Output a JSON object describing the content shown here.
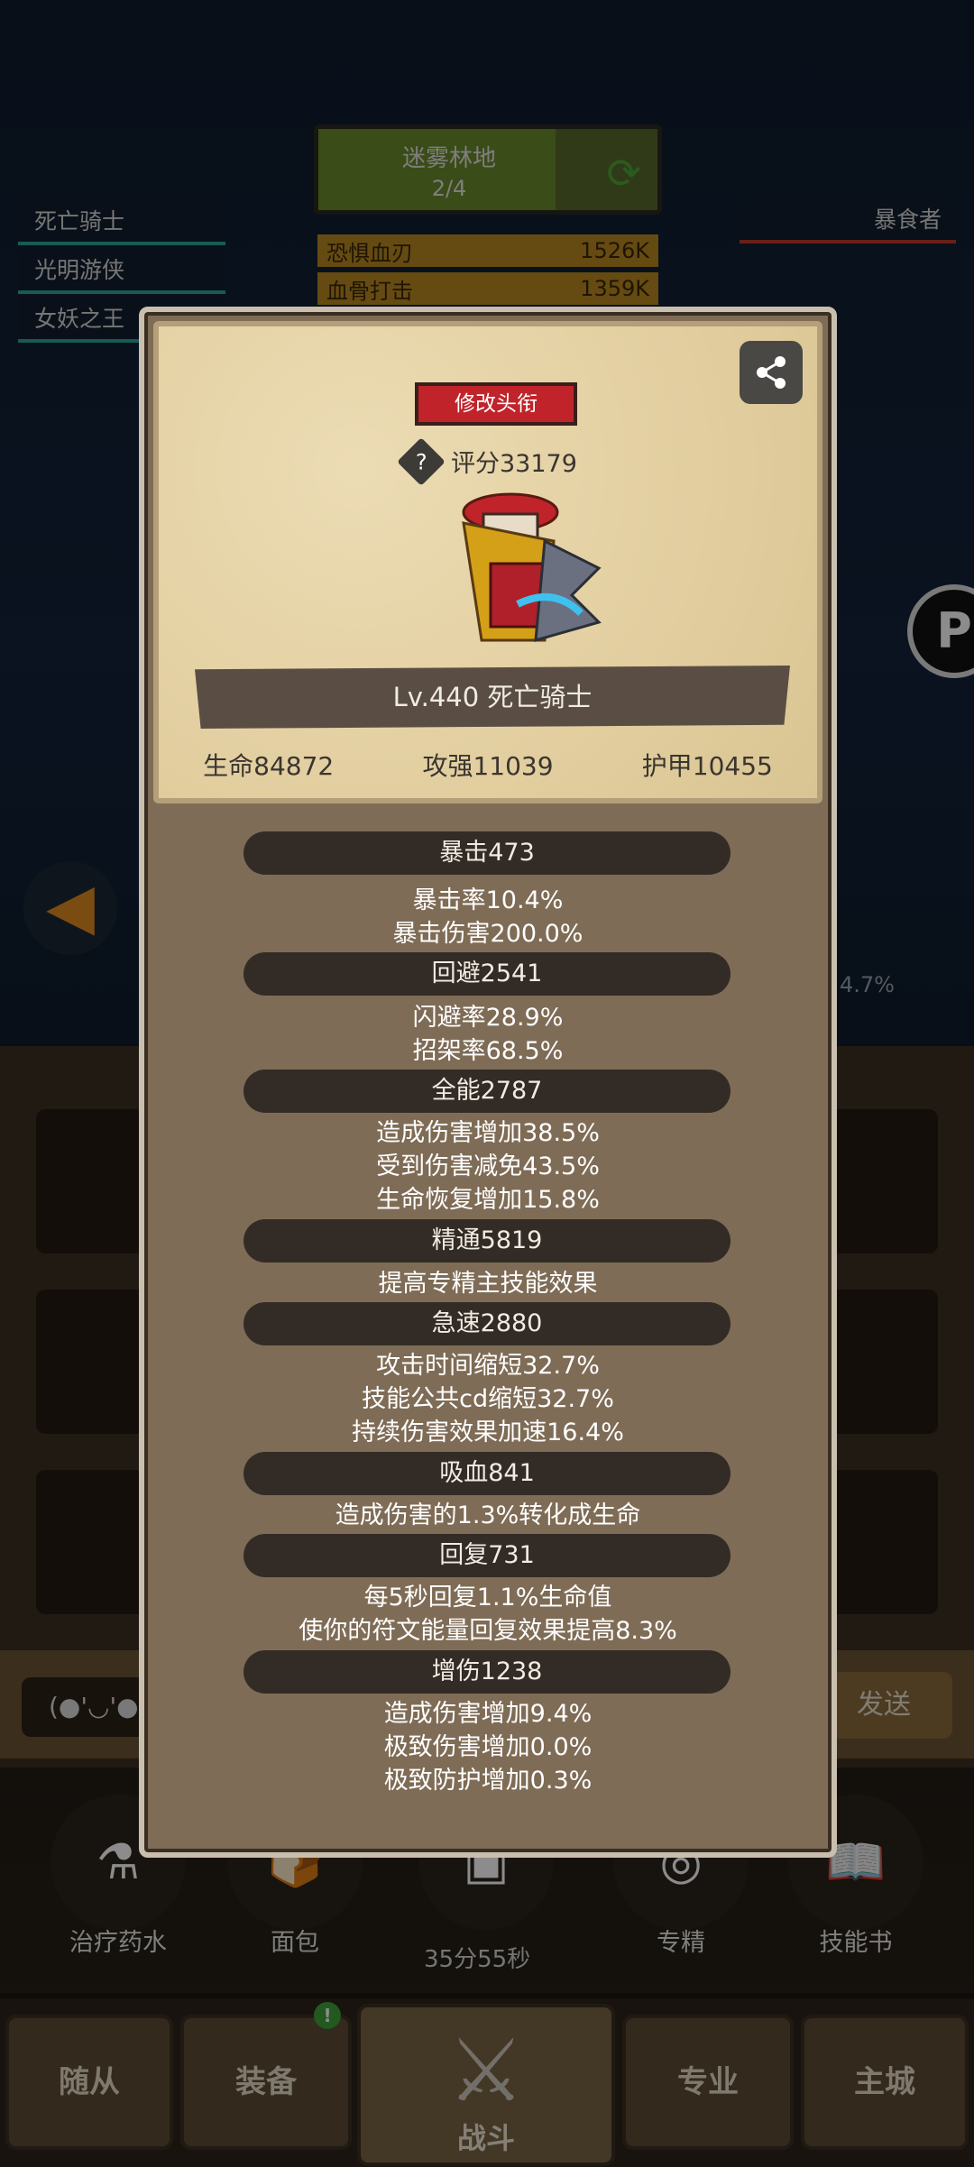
{
  "background": {
    "zone": {
      "name": "迷雾林地",
      "progress": "2/4"
    },
    "party": [
      "死亡骑士",
      "光明游侠",
      "女妖之王"
    ],
    "enemy": "暴食者",
    "damage": [
      {
        "name": "恐惧血刃",
        "value": "1526K"
      },
      {
        "name": "血骨打击",
        "value": "1359K"
      }
    ],
    "percent": "4.7%",
    "chat_input": "(●'◡'●",
    "chat_send": "发送",
    "items": [
      {
        "label": "治疗药水"
      },
      {
        "label": "面包"
      },
      {
        "label": ""
      },
      {
        "label": "专精"
      },
      {
        "label": "技能书"
      }
    ],
    "timer": "35分55秒",
    "nav": {
      "followers": "随从",
      "equipment": "装备",
      "fight": "战斗",
      "profession": "专业",
      "main_city": "主城",
      "equipment_badge": "!"
    }
  },
  "modal": {
    "edit_title_label": "修改头衔",
    "score": "评分33179",
    "level_class": "Lv.440 死亡骑士",
    "stats": {
      "hp": "生命84872",
      "attack": "攻强11039",
      "armor": "护甲10455"
    },
    "sections": [
      {
        "title": "暴击473",
        "lines": [
          "暴击率10.4%",
          "暴击伤害200.0%"
        ]
      },
      {
        "title": "回避2541",
        "lines": [
          "闪避率28.9%",
          "招架率68.5%"
        ]
      },
      {
        "title": "全能2787",
        "lines": [
          "造成伤害增加38.5%",
          "受到伤害减免43.5%",
          "生命恢复增加15.8%"
        ]
      },
      {
        "title": "精通5819",
        "lines": [
          "提高专精主技能效果"
        ]
      },
      {
        "title": "急速2880",
        "lines": [
          "攻击时间缩短32.7%",
          "技能公共cd缩短32.7%",
          "持续伤害效果加速16.4%"
        ]
      },
      {
        "title": "吸血841",
        "lines": [
          "造成伤害的1.3%转化成生命"
        ]
      },
      {
        "title": "回复731",
        "lines": [
          "每5秒回复1.1%生命值",
          "使你的符文能量回复效果提高8.3%"
        ]
      },
      {
        "title": "增伤1238",
        "lines": [
          "造成伤害增加9.4%",
          "极致伤害增加0.0%",
          "极致防护增加0.3%"
        ]
      }
    ]
  }
}
